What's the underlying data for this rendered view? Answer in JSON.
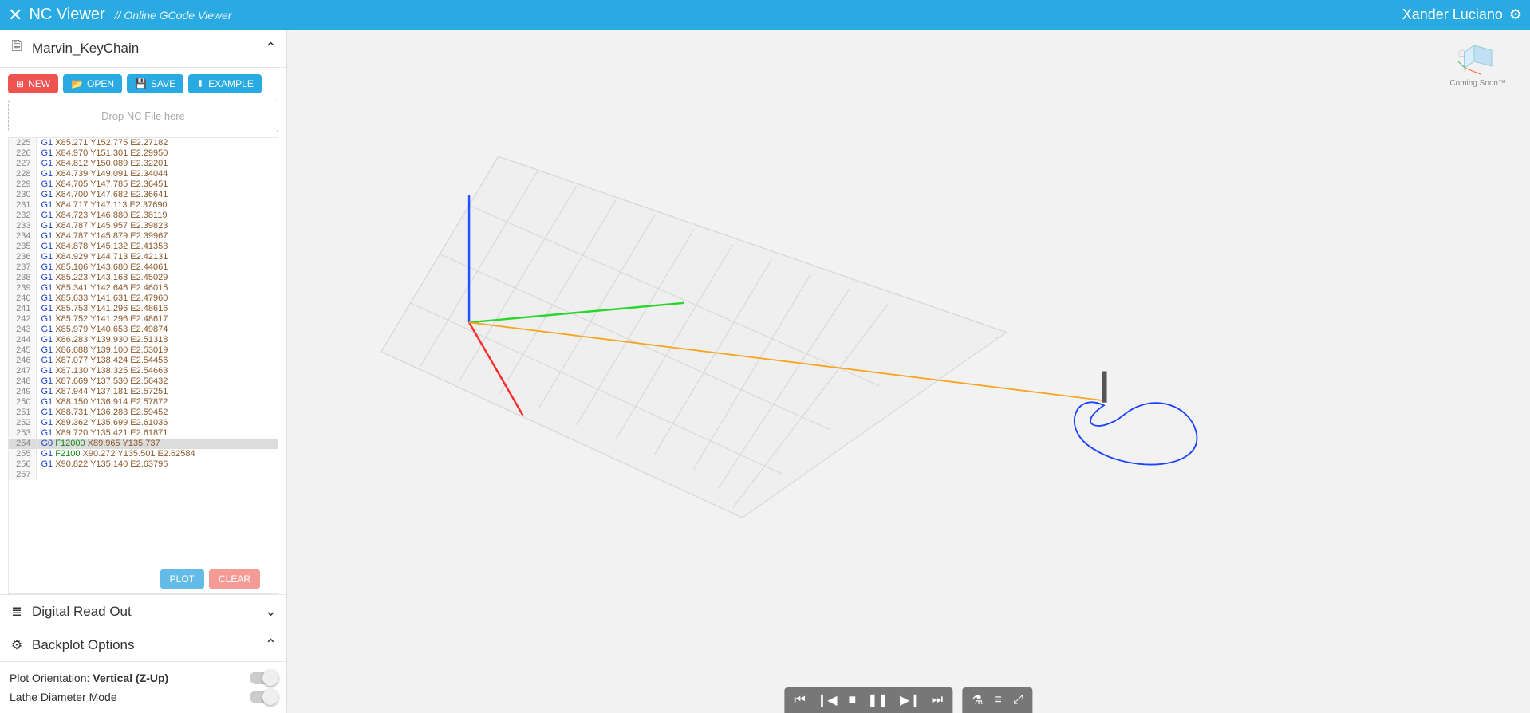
{
  "header": {
    "appName": "NC Viewer",
    "subtitle": "// Online GCode Viewer",
    "userName": "Xander Luciano"
  },
  "filePanel": {
    "title": "Marvin_KeyChain",
    "expanded": true,
    "buttons": {
      "new": "NEW",
      "open": "OPEN",
      "save": "SAVE",
      "example": "EXAMPLE"
    },
    "dropHint": "Drop NC File here",
    "plot": "PLOT",
    "clear": "CLEAR",
    "highlightLine": 254,
    "lines": [
      {
        "n": 225,
        "t": "G1 X85.271 Y152.775 E2.27182"
      },
      {
        "n": 226,
        "t": "G1 X84.970 Y151.301 E2.29950"
      },
      {
        "n": 227,
        "t": "G1 X84.812 Y150.089 E2.32201"
      },
      {
        "n": 228,
        "t": "G1 X84.739 Y149.091 E2.34044"
      },
      {
        "n": 229,
        "t": "G1 X84.705 Y147.785 E2.36451"
      },
      {
        "n": 230,
        "t": "G1 X84.700 Y147.682 E2.36641"
      },
      {
        "n": 231,
        "t": "G1 X84.717 Y147.113 E2.37690"
      },
      {
        "n": 232,
        "t": "G1 X84.723 Y146.880 E2.38119"
      },
      {
        "n": 233,
        "t": "G1 X84.787 Y145.957 E2.39823"
      },
      {
        "n": 234,
        "t": "G1 X84.787 Y145.879 E2.39967"
      },
      {
        "n": 235,
        "t": "G1 X84.878 Y145.132 E2.41353"
      },
      {
        "n": 236,
        "t": "G1 X84.929 Y144.713 E2.42131"
      },
      {
        "n": 237,
        "t": "G1 X85.106 Y143.680 E2.44061"
      },
      {
        "n": 238,
        "t": "G1 X85.223 Y143.168 E2.45029"
      },
      {
        "n": 239,
        "t": "G1 X85.341 Y142.646 E2.46015"
      },
      {
        "n": 240,
        "t": "G1 X85.633 Y141.631 E2.47960"
      },
      {
        "n": 241,
        "t": "G1 X85.753 Y141.296 E2.48616"
      },
      {
        "n": 242,
        "t": "G1 X85.752 Y141.296 E2.48617"
      },
      {
        "n": 243,
        "t": "G1 X85.979 Y140.653 E2.49874"
      },
      {
        "n": 244,
        "t": "G1 X86.283 Y139.930 E2.51318"
      },
      {
        "n": 245,
        "t": "G1 X86.688 Y139.100 E2.53019"
      },
      {
        "n": 246,
        "t": "G1 X87.077 Y138.424 E2.54456"
      },
      {
        "n": 247,
        "t": "G1 X87.130 Y138.325 E2.54663"
      },
      {
        "n": 248,
        "t": "G1 X87.669 Y137.530 E2.56432"
      },
      {
        "n": 249,
        "t": "G1 X87.944 Y137.181 E2.57251"
      },
      {
        "n": 250,
        "t": "G1 X88.150 Y136.914 E2.57872"
      },
      {
        "n": 251,
        "t": "G1 X88.731 Y136.283 E2.59452"
      },
      {
        "n": 252,
        "t": "G1 X89.362 Y135.699 E2.61036"
      },
      {
        "n": 253,
        "t": "G1 X89.720 Y135.421 E2.61871"
      },
      {
        "n": 254,
        "t": "G0 F12000 X89.965 Y135.737"
      },
      {
        "n": 255,
        "t": "G1 F2100 X90.272 Y135.501 E2.62584"
      },
      {
        "n": 256,
        "t": "G1 X90.822 Y135.140 E2.63796"
      },
      {
        "n": 257,
        "t": ""
      }
    ]
  },
  "droPanel": {
    "title": "Digital Read Out",
    "expanded": false
  },
  "backplotPanel": {
    "title": "Backplot Options",
    "expanded": true,
    "orientationLabel": "Plot Orientation:",
    "orientationValue": "Vertical (Z-Up)",
    "latheLabel": "Lathe Diameter Mode"
  },
  "viewport": {
    "comingSoon": "Coming Soon™"
  },
  "icons": {
    "close": "✕",
    "gear": "⚙",
    "file": "🗎",
    "new": "⊞",
    "open": "📂",
    "save": "💾",
    "example": "⬇",
    "dro": "≣",
    "options": "⚙",
    "home": "⌂",
    "chevUp": "⌃",
    "chevDown": "⌄",
    "skipStart": "⏮",
    "stepBack": "❙◀",
    "stop": "■",
    "pause": "❚❚",
    "stepFwd": "▶❙",
    "skipEnd": "⏭",
    "flask": "⚗",
    "sliders": "≡",
    "expand": "⤢"
  }
}
